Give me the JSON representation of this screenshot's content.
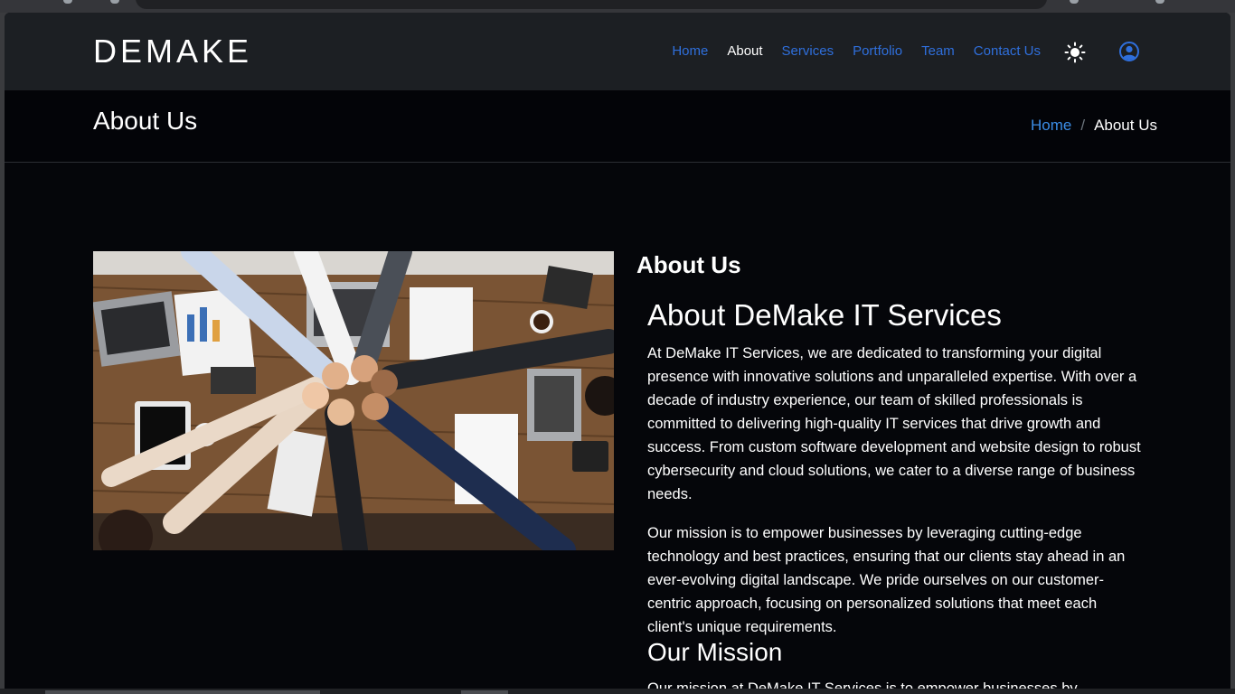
{
  "brand": {
    "logo": "DEMAKE"
  },
  "nav": {
    "items": [
      {
        "label": "Home",
        "active": false
      },
      {
        "label": "About",
        "active": true
      },
      {
        "label": "Services",
        "active": false
      },
      {
        "label": "Portfolio",
        "active": false
      },
      {
        "label": "Team",
        "active": false
      },
      {
        "label": "Contact Us",
        "active": false
      }
    ],
    "theme_toggle_icon": "sun-icon",
    "account_icon": "user-circle-icon"
  },
  "page_header": {
    "title": "About Us",
    "breadcrumb": {
      "home": "Home",
      "separator": "/",
      "current": "About Us"
    }
  },
  "about": {
    "image_icon": "team-fist-bump-photo",
    "section_title": "About Us",
    "heading": "About DeMake IT Services",
    "paragraph1": "At DeMake IT Services, we are dedicated to transforming your digital presence with innovative solutions and unparalleled expertise. With over a decade of industry experience, our team of skilled professionals is committed to delivering high-quality IT services that drive growth and success. From custom software development and website design to robust cybersecurity and cloud solutions, we cater to a diverse range of business needs.",
    "paragraph2": "Our mission is to empower businesses by leveraging cutting-edge technology and best practices, ensuring that our clients stay ahead in an ever-evolving digital landscape. We pride ourselves on our customer-centric approach, focusing on personalized solutions that meet each client's unique requirements.",
    "mission_title": "Our Mission",
    "paragraph3": "Our mission at DeMake IT Services is to empower businesses by"
  },
  "colors": {
    "accent": "#2f6fdc",
    "breadcrumb_link": "#3b8de6",
    "navbar_bg": "#1c1f23",
    "page_bg": "#05060a"
  }
}
